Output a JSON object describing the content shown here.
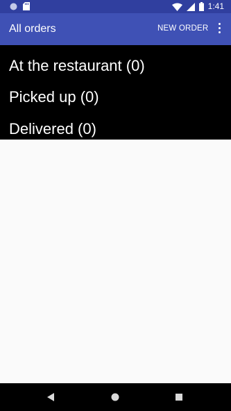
{
  "status_bar": {
    "time": "1:41",
    "icons": [
      "sync-icon",
      "sd-card-icon",
      "wifi-icon",
      "signal-icon",
      "battery-icon"
    ]
  },
  "app_bar": {
    "title": "All orders",
    "action_label": "NEW ORDER",
    "overflow_icon": "more-vert-icon"
  },
  "list": {
    "items": [
      {
        "label": "At the restaurant (0)"
      },
      {
        "label": "Picked up (0)"
      },
      {
        "label": "Delivered (0)"
      }
    ]
  },
  "nav_bar": {
    "icons": [
      "back-icon",
      "home-icon",
      "recents-icon"
    ]
  },
  "colors": {
    "status_bar": "#303f9f",
    "app_bar": "#3f51b5",
    "list_background": "#000000",
    "page_background": "#fafafa"
  }
}
